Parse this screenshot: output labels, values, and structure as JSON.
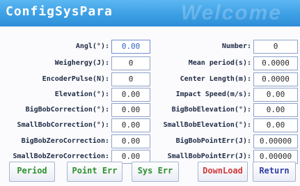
{
  "window": {
    "title": "ConfigSysPara",
    "watermark": "Welcome"
  },
  "left_fields": [
    {
      "label": "Angl(°):",
      "value": "0.00"
    },
    {
      "label": "Weighergy(J):",
      "value": "0"
    },
    {
      "label": "EncoderPulse(N):",
      "value": "0"
    },
    {
      "label": "Elevation(°):",
      "value": "0.00"
    },
    {
      "label": "BigBobCorrection(°):",
      "value": "0.00"
    },
    {
      "label": "SmallBobCorrection(°):",
      "value": "0.00"
    },
    {
      "label": "BigBobZeroCorrection:",
      "value": "0.00"
    },
    {
      "label": "SmallBobZeroCorrection:",
      "value": "0.00"
    }
  ],
  "right_fields": [
    {
      "label": "Number:",
      "value": "0"
    },
    {
      "label": "Mean period(s):",
      "value": "0.0000"
    },
    {
      "label": "Center Length(m):",
      "value": "0.0000"
    },
    {
      "label": "Impact Speed(m/s):",
      "value": "0.00"
    },
    {
      "label": "BigBobElevation(°):",
      "value": "0.00"
    },
    {
      "label": "SmallBobElevation(°):",
      "value": "0.00"
    },
    {
      "label": "BigBobPointErr(J):",
      "value": "0.00000"
    },
    {
      "label": "SmallBobPointErr(J):",
      "value": "0.00000"
    }
  ],
  "buttons": {
    "period": "Period",
    "point_err": "Point Err",
    "sys_err": "Sys Err",
    "download": "DownLoad",
    "return": "Return"
  },
  "colors": {
    "title_bar": "#3d9fe4",
    "green_btn": "#2f8f2f",
    "red_btn": "#d23a3a",
    "blue_btn": "#2f3fa8"
  }
}
